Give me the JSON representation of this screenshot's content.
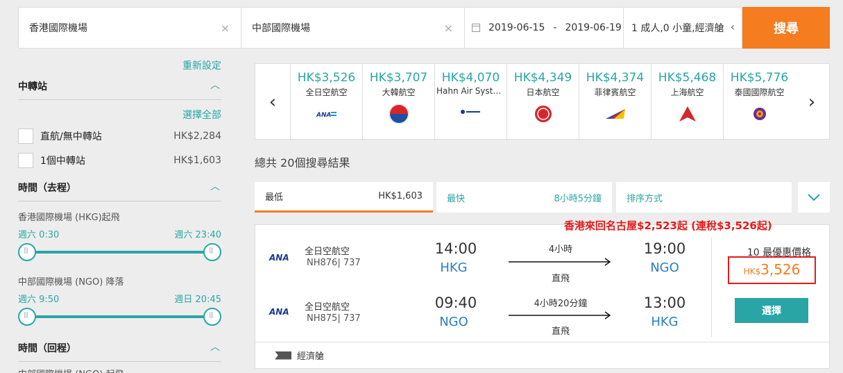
{
  "search": {
    "from": "香港國際機場",
    "to": "中部國際機場",
    "depart_date": "2019-06-15",
    "date_sep": "-",
    "return_date": "2019-06-19",
    "passengers": "1 成人,0 小童,經濟艙",
    "clear_icon": "×",
    "search_label": "搜尋"
  },
  "sidebar": {
    "reset": "重新設定",
    "transit": {
      "title": "中轉站",
      "select_all": "選擇全部",
      "options": [
        {
          "label": "直航/無中轉站",
          "price": "HK$2,284"
        },
        {
          "label": "1個中轉站",
          "price": "HK$1,603"
        }
      ]
    },
    "outbound": {
      "title": "時間（去程）",
      "depart_label": "香港國際機場 (HKG)起飛",
      "depart_min": "週六 0:30",
      "depart_max": "週六 23:40",
      "arrive_label": "中部國際機場 (NGO) 降落",
      "arrive_min": "週六 9:50",
      "arrive_max": "週日 20:45"
    },
    "return": {
      "title": "時間（回程）",
      "depart_label": "中部國際機場 (NGO) 起飛"
    }
  },
  "airlines": [
    {
      "price": "HK$3,526",
      "name": "全日空航空",
      "logo": "ana-logo"
    },
    {
      "price": "HK$3,707",
      "name": "大韓航空",
      "logo": "korean-air-logo"
    },
    {
      "price": "HK$4,070",
      "name": "Hahn Air Syste...",
      "logo": "hahn-air-logo"
    },
    {
      "price": "HK$4,349",
      "name": "日本航空",
      "logo": "jal-logo"
    },
    {
      "price": "HK$4,374",
      "name": "菲律賓航空",
      "logo": "philippine-airlines-logo"
    },
    {
      "price": "HK$5,468",
      "name": "上海航空",
      "logo": "shanghai-airlines-logo"
    },
    {
      "price": "HK$5,776",
      "name": "泰國國際航空",
      "logo": "thai-airways-logo"
    }
  ],
  "results": {
    "total": "總共 20個搜尋結果"
  },
  "sort": {
    "lowest_label": "最低",
    "lowest_value": "HK$1,603",
    "fastest_label": "最快",
    "fastest_value": "8小時5分鐘",
    "order_label": "排序方式"
  },
  "card": {
    "promo": "香港來回名古屋$2,523起 (連稅$3,526起)",
    "ana_text": "ANA",
    "outbound": {
      "airline": "全日空航空",
      "flight": "NH876| 737",
      "dep_time": "14:00",
      "dep_code": "HKG",
      "duration": "4小時",
      "stops": "直飛",
      "arr_time": "19:00",
      "arr_code": "NGO"
    },
    "inbound": {
      "airline": "全日空航空",
      "flight": "NH875| 737",
      "dep_time": "09:40",
      "dep_code": "NGO",
      "duration": "4小時20分鐘",
      "stops": "直飛",
      "arr_time": "13:00",
      "arr_code": "HKG"
    },
    "price_label": "10 最優惠價格",
    "price_currency": "HK$",
    "price_amount": "3,526",
    "select_label": "選擇",
    "cabin": "經濟艙"
  },
  "colors": {
    "accent": "#2aa5a5",
    "orange": "#f57c1f",
    "promo_red": "#e31b1b"
  }
}
